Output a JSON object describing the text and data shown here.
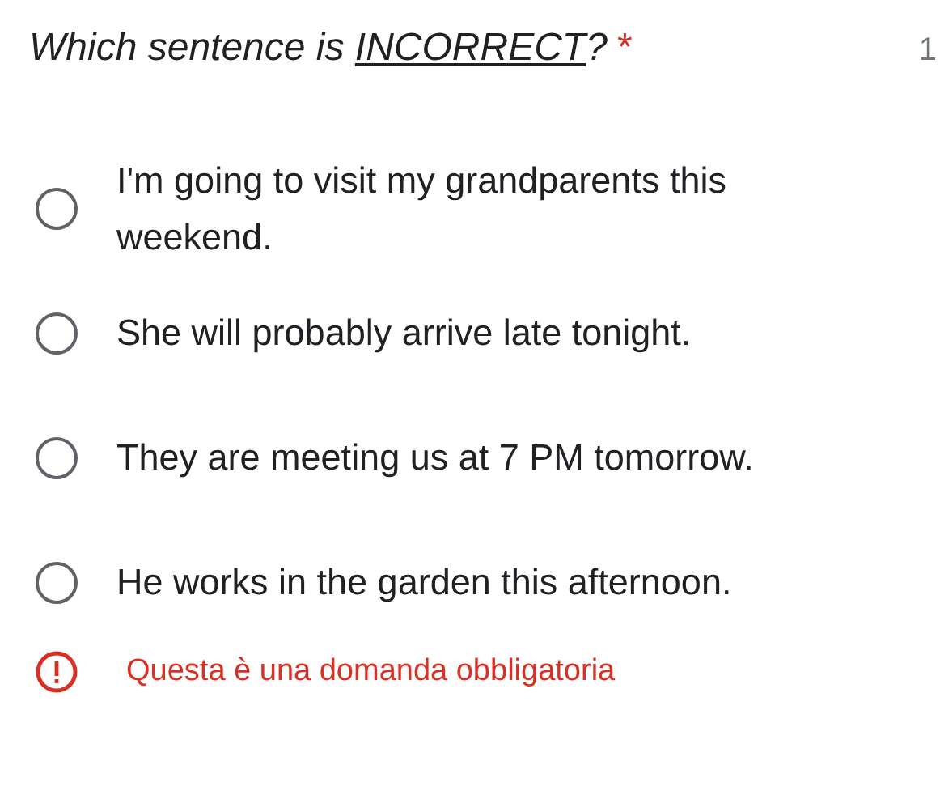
{
  "question": {
    "title_parts": [
      {
        "text": "Which sentence is ",
        "underline": false
      },
      {
        "text": "INCORRECT",
        "underline": true
      },
      {
        "text": "?",
        "underline": false
      }
    ],
    "required_mark": "*",
    "points": "1"
  },
  "options": [
    {
      "label": "I'm going to visit my grandparents this weekend.",
      "selected": false
    },
    {
      "label": "She will probably arrive late tonight.",
      "selected": false
    },
    {
      "label": "They are meeting us at 7 PM tomorrow.",
      "selected": false
    },
    {
      "label": "He works in the garden this afternoon.",
      "selected": false
    }
  ],
  "error": {
    "message": "Questa è una domanda obbligatoria"
  }
}
